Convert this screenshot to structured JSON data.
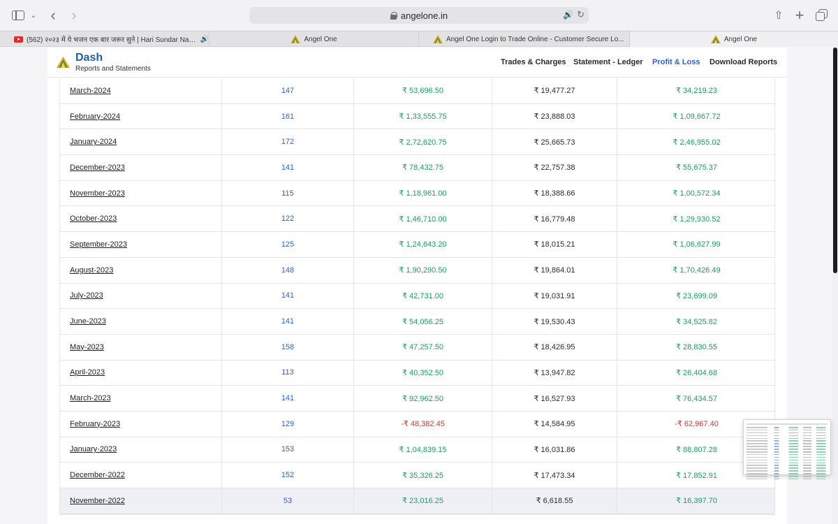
{
  "browser": {
    "address": "angelone.in",
    "tabs": [
      {
        "title": "(562) २०२३ में ये भजन एक बार जरूर सुने | Hari Sundar Nand M...",
        "icon": "youtube-icon",
        "active": false
      },
      {
        "title": "Angel One",
        "icon": "angel-one-icon",
        "active": false
      },
      {
        "title": "Angel One Login to Trade Online - Customer Secure Lo...",
        "icon": "angel-one-icon",
        "active": false
      },
      {
        "title": "Angel One",
        "icon": "angel-one-icon",
        "active": true
      }
    ]
  },
  "app": {
    "title": "Dash",
    "subtitle": "Reports and Statements",
    "nav": {
      "trades": "Trades & Charges",
      "ledger": "Statement - Ledger",
      "pl": "Profit & Loss",
      "download": "Download Reports"
    },
    "active_nav": "Profit & Loss"
  },
  "colors": {
    "positive": "#1f9a62",
    "negative": "#d3332d",
    "link_blue": "#2f5fc0",
    "brand_blue": "#1f5fb0"
  },
  "rows": [
    {
      "month": "March-2024",
      "count": "147",
      "turnover": "₹ 53,696.50",
      "charges": "₹ 19,477.27",
      "net": "₹ 34,219.23"
    },
    {
      "month": "February-2024",
      "count": "161",
      "turnover": "₹ 1,33,555.75",
      "charges": "₹ 23,888.03",
      "net": "₹ 1,09,667.72"
    },
    {
      "month": "January-2024",
      "count": "172",
      "turnover": "₹ 2,72,620.75",
      "charges": "₹ 25,665.73",
      "net": "₹ 2,46,955.02"
    },
    {
      "month": "December-2023",
      "count": "141",
      "turnover": "₹ 78,432.75",
      "charges": "₹ 22,757.38",
      "net": "₹ 55,675.37"
    },
    {
      "month": "November-2023",
      "count": "115",
      "turnover": "₹ 1,18,961.00",
      "charges": "₹ 18,388.66",
      "net": "₹ 1,00,572.34"
    },
    {
      "month": "October-2023",
      "count": "122",
      "turnover": "₹ 1,46,710.00",
      "charges": "₹ 16,779.48",
      "net": "₹ 1,29,930.52"
    },
    {
      "month": "September-2023",
      "count": "125",
      "turnover": "₹ 1,24,643.20",
      "charges": "₹ 18,015.21",
      "net": "₹ 1,06,627.99"
    },
    {
      "month": "August-2023",
      "count": "148",
      "turnover": "₹ 1,90,290.50",
      "charges": "₹ 19,864.01",
      "net": "₹ 1,70,426.49"
    },
    {
      "month": "July-2023",
      "count": "141",
      "turnover": "₹ 42,731.00",
      "charges": "₹ 19,031.91",
      "net": "₹ 23,699.09"
    },
    {
      "month": "June-2023",
      "count": "141",
      "turnover": "₹ 54,056.25",
      "charges": "₹ 19,530.43",
      "net": "₹ 34,525.82"
    },
    {
      "month": "May-2023",
      "count": "158",
      "turnover": "₹ 47,257.50",
      "charges": "₹ 18,426.95",
      "net": "₹ 28,830.55"
    },
    {
      "month": "April-2023",
      "count": "113",
      "turnover": "₹ 40,352.50",
      "charges": "₹ 13,947.82",
      "net": "₹ 26,404.68"
    },
    {
      "month": "March-2023",
      "count": "141",
      "turnover": "₹ 92,962.50",
      "charges": "₹ 16,527.93",
      "net": "₹ 76,434.57"
    },
    {
      "month": "February-2023",
      "count": "129",
      "turnover": "-₹ 48,382.45",
      "charges": "₹ 14,584.95",
      "net": "-₹ 62,967.40"
    },
    {
      "month": "January-2023",
      "count": "153",
      "turnover": "₹ 1,04,839.15",
      "charges": "₹ 16,031.86",
      "net": "₹ 88,807.28"
    },
    {
      "month": "December-2022",
      "count": "152",
      "turnover": "₹ 35,326.25",
      "charges": "₹ 17,473.34",
      "net": "₹ 17,852.91"
    },
    {
      "month": "November-2022",
      "count": "53",
      "turnover": "₹ 23,016.25",
      "charges": "₹ 6,618.55",
      "net": "₹ 16,397.70"
    }
  ]
}
